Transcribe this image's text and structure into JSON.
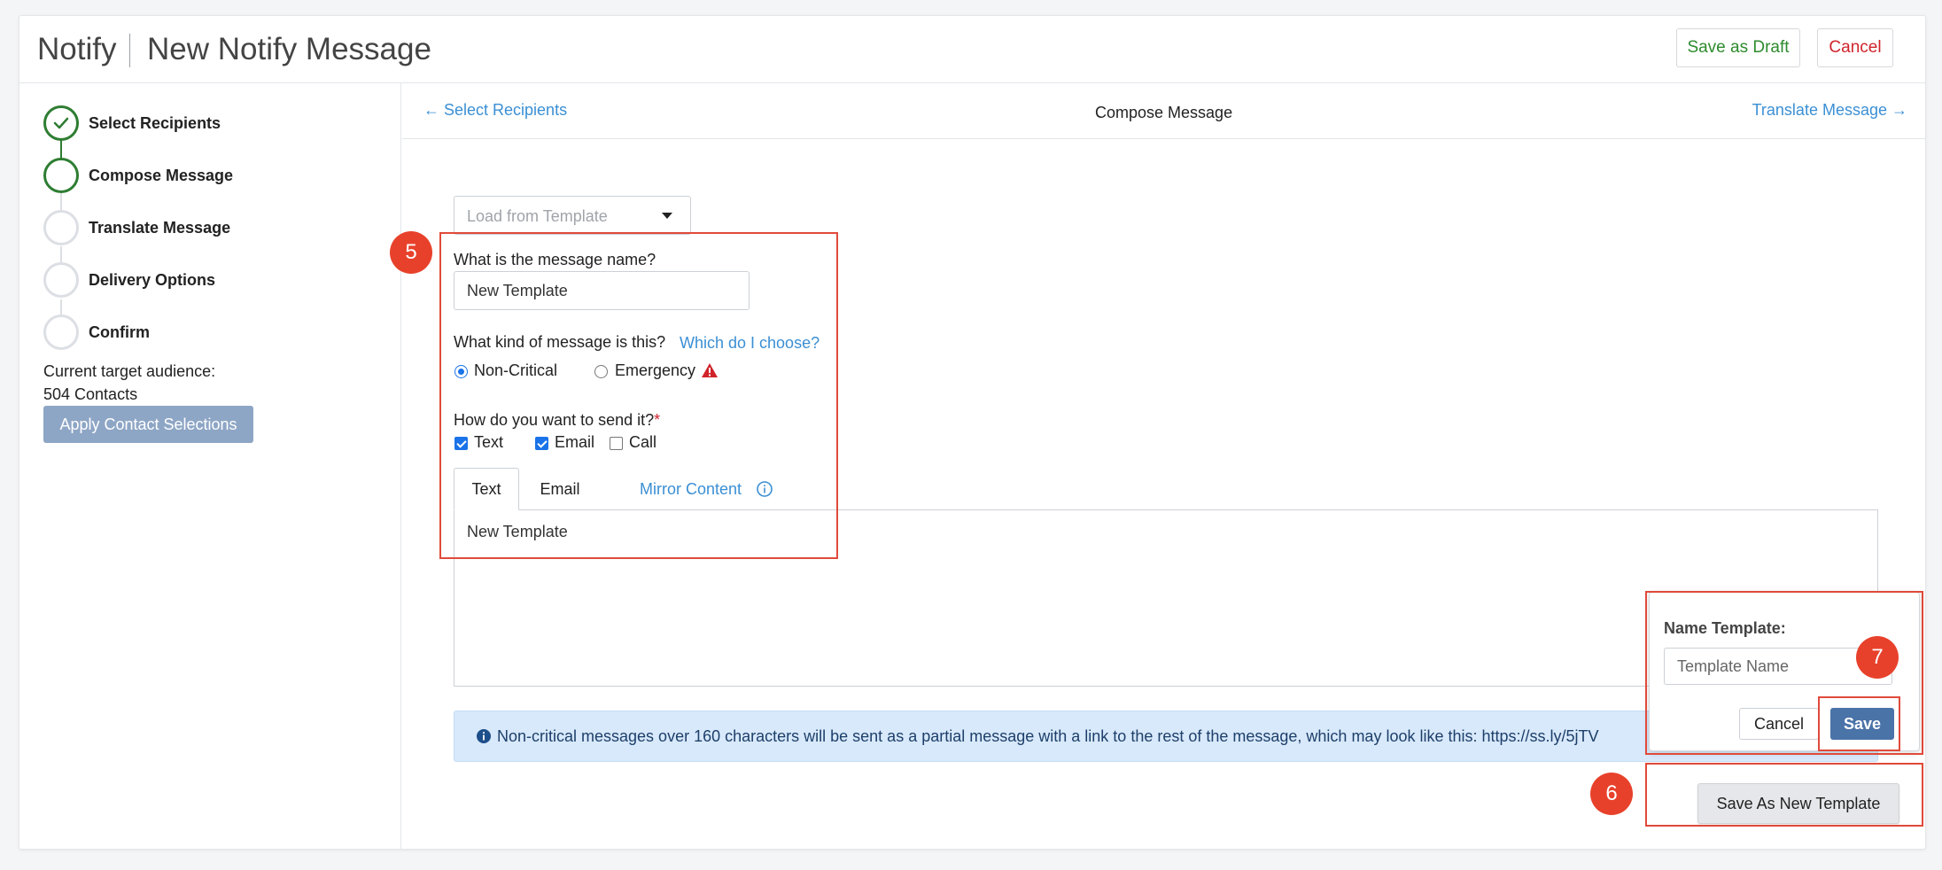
{
  "header": {
    "app_title": "Notify",
    "page_title": "New Notify Message",
    "save_draft_label": "Save as Draft",
    "cancel_label": "Cancel"
  },
  "sidebar": {
    "steps": [
      {
        "label": "Select Recipients",
        "state": "done"
      },
      {
        "label": "Compose Message",
        "state": "active"
      },
      {
        "label": "Translate Message",
        "state": "pending"
      },
      {
        "label": "Delivery Options",
        "state": "pending"
      },
      {
        "label": "Confirm",
        "state": "pending"
      }
    ],
    "audience_label": "Current target audience:",
    "audience_count": "504 Contacts",
    "apply_label": "Apply Contact Selections"
  },
  "subnav": {
    "back_label": "← Select Recipients",
    "current_label": "Compose Message",
    "next_label": "Translate Message →"
  },
  "form": {
    "template_placeholder": "Load from Template",
    "name_question": "What is the message name?",
    "name_value": "New Template",
    "kind_question": "What kind of message is this?",
    "kind_help": "Which do I choose?",
    "kind_options": [
      "Non-Critical",
      "Emergency"
    ],
    "kind_selected": "Non-Critical",
    "send_question": "How do you want to send it?",
    "required_mark": "*",
    "send_options": [
      {
        "label": "Text",
        "checked": true
      },
      {
        "label": "Email",
        "checked": true
      },
      {
        "label": "Call",
        "checked": false
      }
    ],
    "tabs": [
      "Text",
      "Email"
    ],
    "mirror_label": "Mirror Content",
    "editor_text": "New Template",
    "info_text": "Non-critical messages over 160 characters will be sent as a partial message with a link to the rest of the message, which may look like this: https://ss.ly/5jTV"
  },
  "popover": {
    "title": "Name Template:",
    "placeholder": "Template Name",
    "cancel_label": "Cancel",
    "save_label": "Save"
  },
  "save_new_label": "Save As New Template",
  "annotations": {
    "badge_5": "5",
    "badge_6": "6",
    "badge_7": "7"
  },
  "colors": {
    "accent_blue": "#3b8fd4",
    "success_green": "#2e7d32",
    "danger_red": "#d0242b",
    "annotation_red": "#e8412b",
    "save_blue": "#4a73a8"
  }
}
